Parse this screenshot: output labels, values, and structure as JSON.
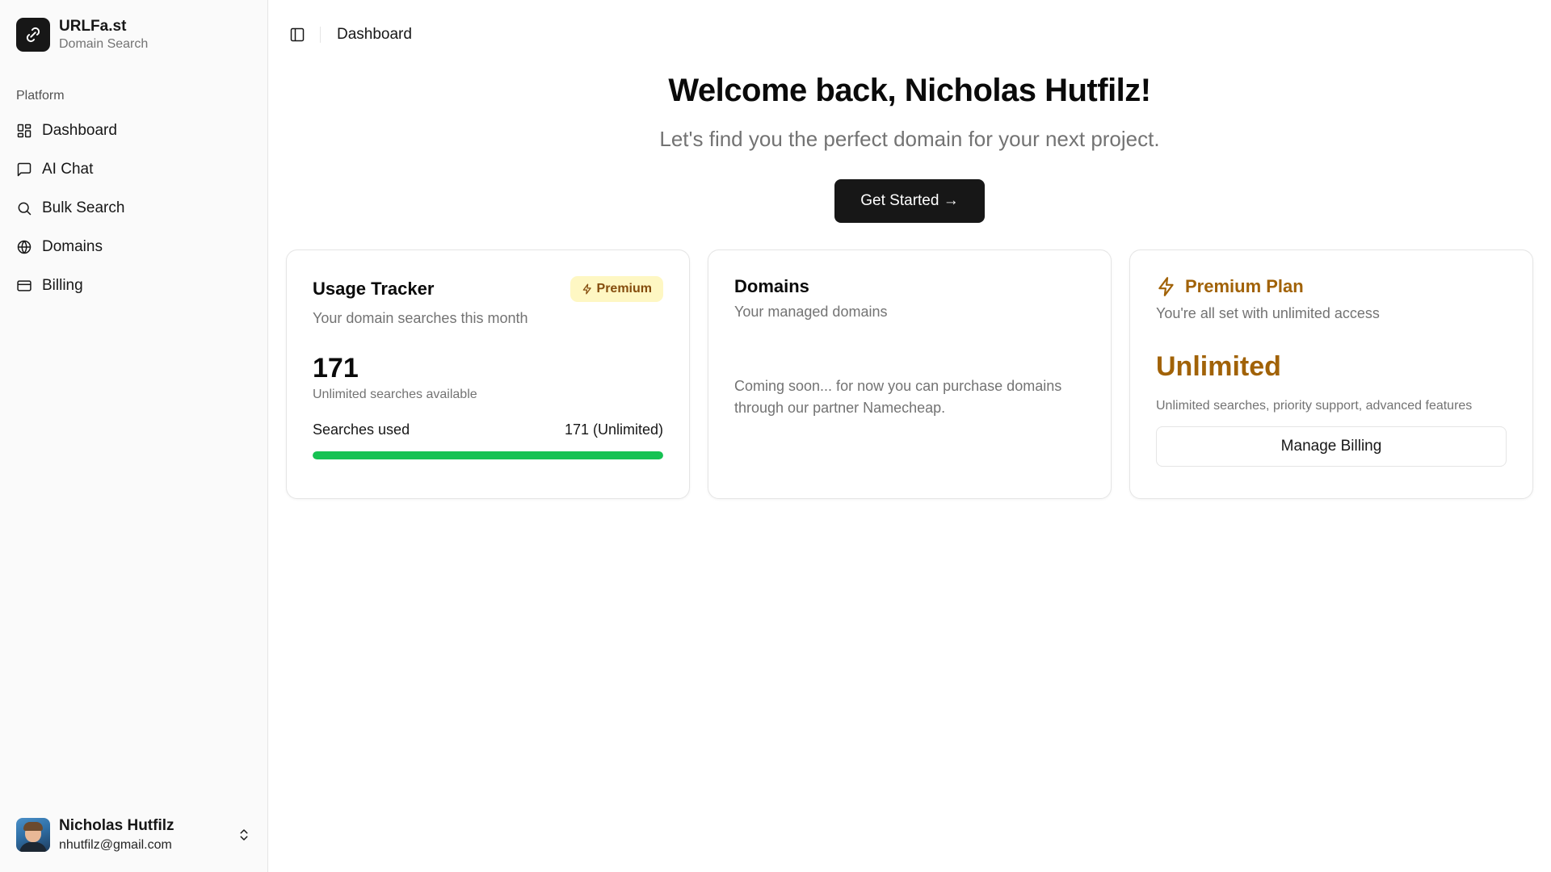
{
  "brand": {
    "name": "URLFa.st",
    "subtitle": "Domain Search"
  },
  "sidebar": {
    "group_label": "Platform",
    "items": [
      {
        "label": "Dashboard",
        "icon": "dashboard-icon"
      },
      {
        "label": "AI Chat",
        "icon": "message-icon"
      },
      {
        "label": "Bulk Search",
        "icon": "search-icon"
      },
      {
        "label": "Domains",
        "icon": "globe-icon"
      },
      {
        "label": "Billing",
        "icon": "credit-card-icon"
      }
    ]
  },
  "user": {
    "name": "Nicholas Hutfilz",
    "email": "nhutfilz@gmail.com"
  },
  "header": {
    "breadcrumb": "Dashboard"
  },
  "hero": {
    "title": "Welcome back, Nicholas Hutfilz!",
    "subtitle": "Let's find you the perfect domain for your next project.",
    "cta_label": "Get Started →"
  },
  "usage_card": {
    "title": "Usage Tracker",
    "badge": "Premium",
    "description": "Your domain searches this month",
    "count": "171",
    "count_caption": "Unlimited searches available",
    "row_label": "Searches used",
    "row_value": "171 (Unlimited)",
    "progress_fraction": 1.0,
    "progress_color": "#16c253"
  },
  "domains_card": {
    "title": "Domains",
    "description": "Your managed domains",
    "message": "Coming soon... for now you can purchase domains through our partner Namecheap."
  },
  "plan_card": {
    "title": "Premium Plan",
    "description": "You're all set with unlimited access",
    "headline": "Unlimited",
    "features": "Unlimited searches, priority support, advanced features",
    "button_label": "Manage Billing",
    "accent_color": "#a16207"
  }
}
